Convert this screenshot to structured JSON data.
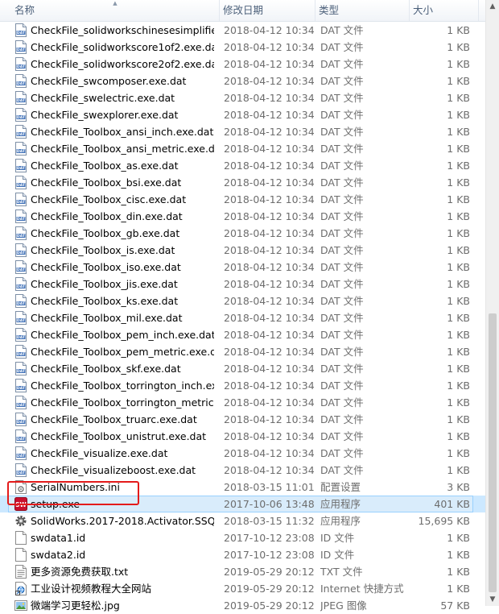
{
  "columns": {
    "name": "名称",
    "date": "修改日期",
    "type": "类型",
    "size": "大小"
  },
  "files": [
    {
      "name": "CheckFile_solidworkschinesesimplifie...",
      "date": "2018-04-12 10:34",
      "type": "DAT 文件",
      "size": "1 KB",
      "icon": "dat-file-icon"
    },
    {
      "name": "CheckFile_solidworkscore1of2.exe.dat",
      "date": "2018-04-12 10:34",
      "type": "DAT 文件",
      "size": "1 KB",
      "icon": "dat-file-icon"
    },
    {
      "name": "CheckFile_solidworkscore2of2.exe.dat",
      "date": "2018-04-12 10:34",
      "type": "DAT 文件",
      "size": "1 KB",
      "icon": "dat-file-icon"
    },
    {
      "name": "CheckFile_swcomposer.exe.dat",
      "date": "2018-04-12 10:34",
      "type": "DAT 文件",
      "size": "1 KB",
      "icon": "dat-file-icon"
    },
    {
      "name": "CheckFile_swelectric.exe.dat",
      "date": "2018-04-12 10:34",
      "type": "DAT 文件",
      "size": "1 KB",
      "icon": "dat-file-icon"
    },
    {
      "name": "CheckFile_swexplorer.exe.dat",
      "date": "2018-04-12 10:34",
      "type": "DAT 文件",
      "size": "1 KB",
      "icon": "dat-file-icon"
    },
    {
      "name": "CheckFile_Toolbox_ansi_inch.exe.dat",
      "date": "2018-04-12 10:34",
      "type": "DAT 文件",
      "size": "1 KB",
      "icon": "dat-file-icon"
    },
    {
      "name": "CheckFile_Toolbox_ansi_metric.exe.dat",
      "date": "2018-04-12 10:34",
      "type": "DAT 文件",
      "size": "1 KB",
      "icon": "dat-file-icon"
    },
    {
      "name": "CheckFile_Toolbox_as.exe.dat",
      "date": "2018-04-12 10:34",
      "type": "DAT 文件",
      "size": "1 KB",
      "icon": "dat-file-icon"
    },
    {
      "name": "CheckFile_Toolbox_bsi.exe.dat",
      "date": "2018-04-12 10:34",
      "type": "DAT 文件",
      "size": "1 KB",
      "icon": "dat-file-icon"
    },
    {
      "name": "CheckFile_Toolbox_cisc.exe.dat",
      "date": "2018-04-12 10:34",
      "type": "DAT 文件",
      "size": "1 KB",
      "icon": "dat-file-icon"
    },
    {
      "name": "CheckFile_Toolbox_din.exe.dat",
      "date": "2018-04-12 10:34",
      "type": "DAT 文件",
      "size": "1 KB",
      "icon": "dat-file-icon"
    },
    {
      "name": "CheckFile_Toolbox_gb.exe.dat",
      "date": "2018-04-12 10:34",
      "type": "DAT 文件",
      "size": "1 KB",
      "icon": "dat-file-icon"
    },
    {
      "name": "CheckFile_Toolbox_is.exe.dat",
      "date": "2018-04-12 10:34",
      "type": "DAT 文件",
      "size": "1 KB",
      "icon": "dat-file-icon"
    },
    {
      "name": "CheckFile_Toolbox_iso.exe.dat",
      "date": "2018-04-12 10:34",
      "type": "DAT 文件",
      "size": "1 KB",
      "icon": "dat-file-icon"
    },
    {
      "name": "CheckFile_Toolbox_jis.exe.dat",
      "date": "2018-04-12 10:34",
      "type": "DAT 文件",
      "size": "1 KB",
      "icon": "dat-file-icon"
    },
    {
      "name": "CheckFile_Toolbox_ks.exe.dat",
      "date": "2018-04-12 10:34",
      "type": "DAT 文件",
      "size": "1 KB",
      "icon": "dat-file-icon"
    },
    {
      "name": "CheckFile_Toolbox_mil.exe.dat",
      "date": "2018-04-12 10:34",
      "type": "DAT 文件",
      "size": "1 KB",
      "icon": "dat-file-icon"
    },
    {
      "name": "CheckFile_Toolbox_pem_inch.exe.dat",
      "date": "2018-04-12 10:34",
      "type": "DAT 文件",
      "size": "1 KB",
      "icon": "dat-file-icon"
    },
    {
      "name": "CheckFile_Toolbox_pem_metric.exe.dat",
      "date": "2018-04-12 10:34",
      "type": "DAT 文件",
      "size": "1 KB",
      "icon": "dat-file-icon"
    },
    {
      "name": "CheckFile_Toolbox_skf.exe.dat",
      "date": "2018-04-12 10:34",
      "type": "DAT 文件",
      "size": "1 KB",
      "icon": "dat-file-icon"
    },
    {
      "name": "CheckFile_Toolbox_torrington_inch.ex...",
      "date": "2018-04-12 10:34",
      "type": "DAT 文件",
      "size": "1 KB",
      "icon": "dat-file-icon"
    },
    {
      "name": "CheckFile_Toolbox_torrington_metric....",
      "date": "2018-04-12 10:34",
      "type": "DAT 文件",
      "size": "1 KB",
      "icon": "dat-file-icon"
    },
    {
      "name": "CheckFile_Toolbox_truarc.exe.dat",
      "date": "2018-04-12 10:34",
      "type": "DAT 文件",
      "size": "1 KB",
      "icon": "dat-file-icon"
    },
    {
      "name": "CheckFile_Toolbox_unistrut.exe.dat",
      "date": "2018-04-12 10:34",
      "type": "DAT 文件",
      "size": "1 KB",
      "icon": "dat-file-icon"
    },
    {
      "name": "CheckFile_visualize.exe.dat",
      "date": "2018-04-12 10:34",
      "type": "DAT 文件",
      "size": "1 KB",
      "icon": "dat-file-icon"
    },
    {
      "name": "CheckFile_visualizeboost.exe.dat",
      "date": "2018-04-12 10:34",
      "type": "DAT 文件",
      "size": "1 KB",
      "icon": "dat-file-icon"
    },
    {
      "name": "SerialNumbers.ini",
      "date": "2018-03-15 11:01",
      "type": "配置设置",
      "size": "3 KB",
      "icon": "ini-file-icon"
    },
    {
      "name": "setup.exe",
      "date": "2017-10-06 13:48",
      "type": "应用程序",
      "size": "401 KB",
      "icon": "solidworks-setup-icon",
      "selected": true
    },
    {
      "name": "SolidWorks.2017-2018.Activator.SSQ....",
      "date": "2018-03-15 11:32",
      "type": "应用程序",
      "size": "15,695 KB",
      "icon": "gear-app-icon"
    },
    {
      "name": "swdata1.id",
      "date": "2017-10-12 23:08",
      "type": "ID 文件",
      "size": "1 KB",
      "icon": "blank-file-icon"
    },
    {
      "name": "swdata2.id",
      "date": "2017-10-12 23:08",
      "type": "ID 文件",
      "size": "1 KB",
      "icon": "blank-file-icon"
    },
    {
      "name": "更多资源免费获取.txt",
      "date": "2019-05-29 20:12",
      "type": "TXT 文件",
      "size": "1 KB",
      "icon": "text-file-icon"
    },
    {
      "name": "工业设计视频教程大全网站",
      "date": "2019-05-29 20:12",
      "type": "Internet 快捷方式",
      "size": "1 KB",
      "icon": "internet-shortcut-icon"
    },
    {
      "name": "微端学习更轻松.jpg",
      "date": "2019-05-29 20:12",
      "type": "JPEG 图像",
      "size": "57 KB",
      "icon": "image-file-icon"
    }
  ]
}
